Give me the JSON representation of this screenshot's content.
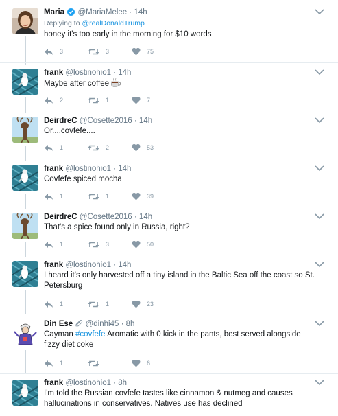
{
  "tweets": [
    {
      "name": "Maria",
      "verified": true,
      "handle": "@MariaMelee",
      "time": "14h",
      "reply_prefix": "Replying to",
      "reply_to": "@realDonaldTrump",
      "text": "honey it's too early in the morning for $10 words",
      "replies": "3",
      "retweets": "3",
      "likes": "75",
      "avatar": "woman-photo"
    },
    {
      "name": "frank",
      "handle": "@lostinohio1",
      "time": "14h",
      "text": "Maybe after coffee",
      "emoji": "hot-beverage",
      "replies": "2",
      "retweets": "1",
      "likes": "7",
      "avatar": "bird-fence"
    },
    {
      "name": "DeirdreC",
      "handle": "@Cosette2016",
      "time": "14h",
      "text": "Or....covfefe....",
      "replies": "1",
      "retweets": "2",
      "likes": "53",
      "avatar": "moose-sky"
    },
    {
      "name": "frank",
      "handle": "@lostinohio1",
      "time": "14h",
      "text": "Covfefe spiced mocha",
      "replies": "1",
      "retweets": "1",
      "likes": "39",
      "avatar": "bird-fence"
    },
    {
      "name": "DeirdreC",
      "handle": "@Cosette2016",
      "time": "14h",
      "text": "That's a spice found only in Russia, right?",
      "replies": "1",
      "retweets": "3",
      "likes": "50",
      "avatar": "moose-sky"
    },
    {
      "name": "frank",
      "handle": "@lostinohio1",
      "time": "14h",
      "text": "I heard it's only harvested off a tiny island in the Baltic Sea off the coast so St. Petersburg",
      "replies": "1",
      "retweets": "1",
      "likes": "23",
      "avatar": "bird-fence"
    },
    {
      "name": "Din Ese",
      "handle": "@dinhi45",
      "time": "8h",
      "text_before": "Cayman ",
      "hashtag": "#covfefe",
      "text_after": " Aromatic with 0 kick in the pants, best served alongside fizzy diet coke",
      "replies": "1",
      "likes": "6",
      "avatar": "cartoon-figure"
    },
    {
      "name": "frank",
      "handle": "@lostinohio1",
      "time": "8h",
      "text": "I'm told the Russian covfefe tastes like cinnamon & nutmeg and causes hallucinations in conservatives. Natives use has declined",
      "avatar": "bird-fence"
    }
  ],
  "colors": {
    "link": "#1b95e0",
    "muted": "#657786",
    "icon": "#8899a6",
    "thread_line": "#ccd6dd"
  }
}
